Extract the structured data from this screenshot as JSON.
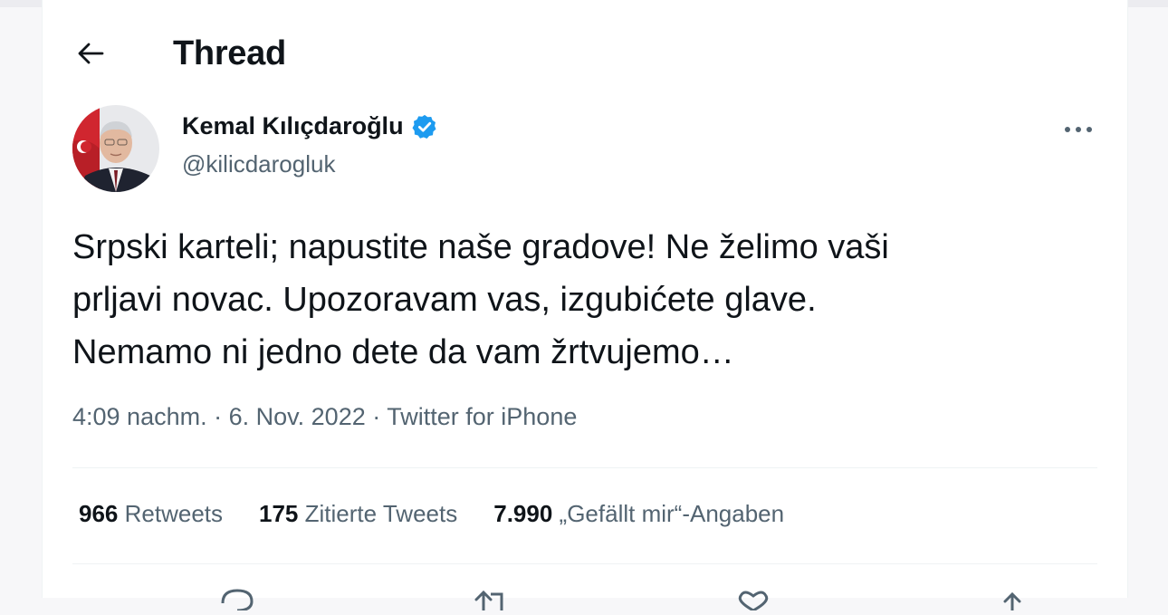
{
  "header": {
    "title": "Thread"
  },
  "tweet": {
    "author_name": "Kemal Kılıçdaroğlu",
    "handle": "@kilicdarogluk",
    "text": "Srpski karteli; napustite naše gradove! Ne želimo vaši\nprljavi novac. Upozoravam vas, izgubićete glave.\nNemamo ni jedno dete da vam žrtvujemo…",
    "time": "4:09 nachm.",
    "date": "6. Nov. 2022",
    "source": "Twitter for iPhone",
    "separator": "·"
  },
  "stats": {
    "retweets_count": "966",
    "retweets_label": "Retweets",
    "quotes_count": "175",
    "quotes_label": "Zitierte Tweets",
    "likes_count": "7.990",
    "likes_label": "„Gefällt mir“-Angaben"
  },
  "colors": {
    "text_primary": "#0f1419",
    "text_secondary": "#536471",
    "verified_blue": "#1d9bf0",
    "divider": "#eff3f4"
  },
  "icons": {
    "back": "arrow-left-icon",
    "verified": "verified-badge-icon",
    "more": "more-horizontal-icon",
    "reply": "reply-icon",
    "retweet": "retweet-icon",
    "like": "heart-icon",
    "share": "share-icon"
  }
}
